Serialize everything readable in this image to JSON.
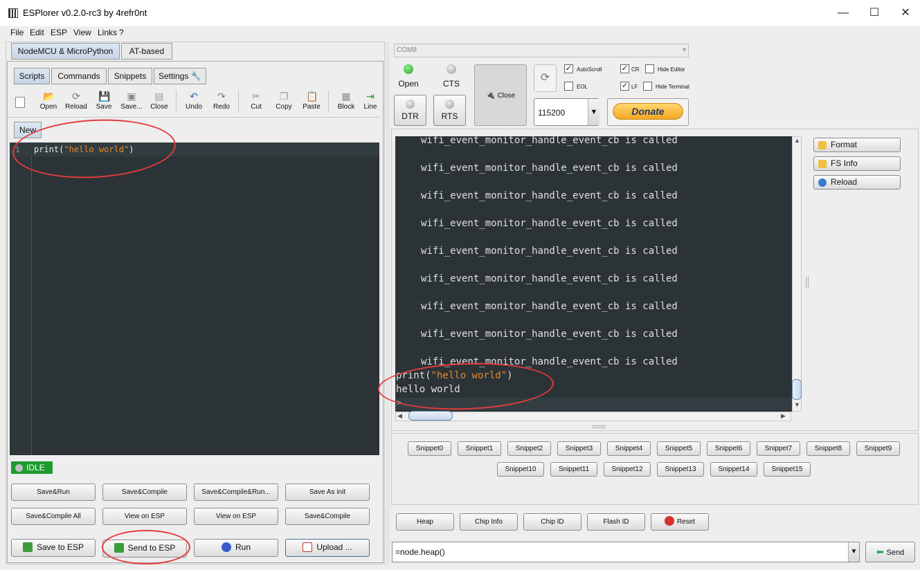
{
  "window": {
    "title": "ESPlorer v0.2.0-rc3 by 4refr0nt",
    "minimize": "—",
    "maximize": "☐",
    "close": "✕"
  },
  "menu": [
    "File",
    "Edit",
    "ESP",
    "View",
    "Links",
    "?"
  ],
  "left": {
    "top_tabs": [
      "NodeMCU & MicroPython",
      "AT-based"
    ],
    "sub_tabs": [
      "Scripts",
      "Commands",
      "Snippets",
      "Settings"
    ],
    "toolbar": [
      "Open",
      "Reload",
      "Save",
      "Save...",
      "Close",
      "Undo",
      "Redo",
      "Cut",
      "Copy",
      "Paste",
      "Block",
      "Line"
    ],
    "file_tab": "New",
    "editor": {
      "line_number": "1",
      "code_prefix": "print(",
      "code_string": "\"hello world\"",
      "code_suffix": ")"
    },
    "status": "IDLE",
    "buttons_row1": [
      "Save&Run",
      "Save&Compile",
      "Save&Compile&Run...",
      "Save As init"
    ],
    "buttons_row2": [
      "Save&Compile All",
      "View on ESP",
      "View on ESP",
      "Save&Compile"
    ],
    "buttons_row3": [
      "Save to ESP",
      "Send to ESP",
      "Run",
      "Upload ..."
    ]
  },
  "right": {
    "port": "COM8",
    "open": "Open",
    "cts": "CTS",
    "close_port": "Close",
    "dtr": "DTR",
    "rts": "RTS",
    "checkboxes": {
      "autoscroll": "AutoScroll",
      "eol": "EOL",
      "cr": "CR",
      "lf": "LF",
      "hide_editor": "Hide Editor",
      "hide_terminal": "Hide Terminal"
    },
    "checks": {
      "autoscroll": "✓",
      "cr": "✓",
      "lf": "✓"
    },
    "baud": "115200",
    "donate": "Donate",
    "side_buttons": [
      "Format",
      "FS Info",
      "Reload"
    ],
    "terminal": {
      "repeat_line": "wifi_event_monitor_handle_event_cb is called",
      "cmd_prefix": "print(",
      "cmd_string": "\"hello world\"",
      "cmd_suffix": ")",
      "output": "hello world",
      "prompt": ">"
    },
    "snippets_row1": [
      "Snippet0",
      "Snippet1",
      "Snippet2",
      "Snippet3",
      "Snippet4",
      "Snippet5",
      "Snippet6",
      "Snippet7",
      "Snippet8",
      "Snippet9"
    ],
    "snippets_row2": [
      "Snippet10",
      "Snippet11",
      "Snippet12",
      "Snippet13",
      "Snippet14",
      "Snippet15"
    ],
    "bottom_buttons": [
      "Heap",
      "Chip Info",
      "Chip ID",
      "Flash ID",
      "Reset"
    ],
    "command_input": "=node.heap()",
    "send": "Send"
  }
}
